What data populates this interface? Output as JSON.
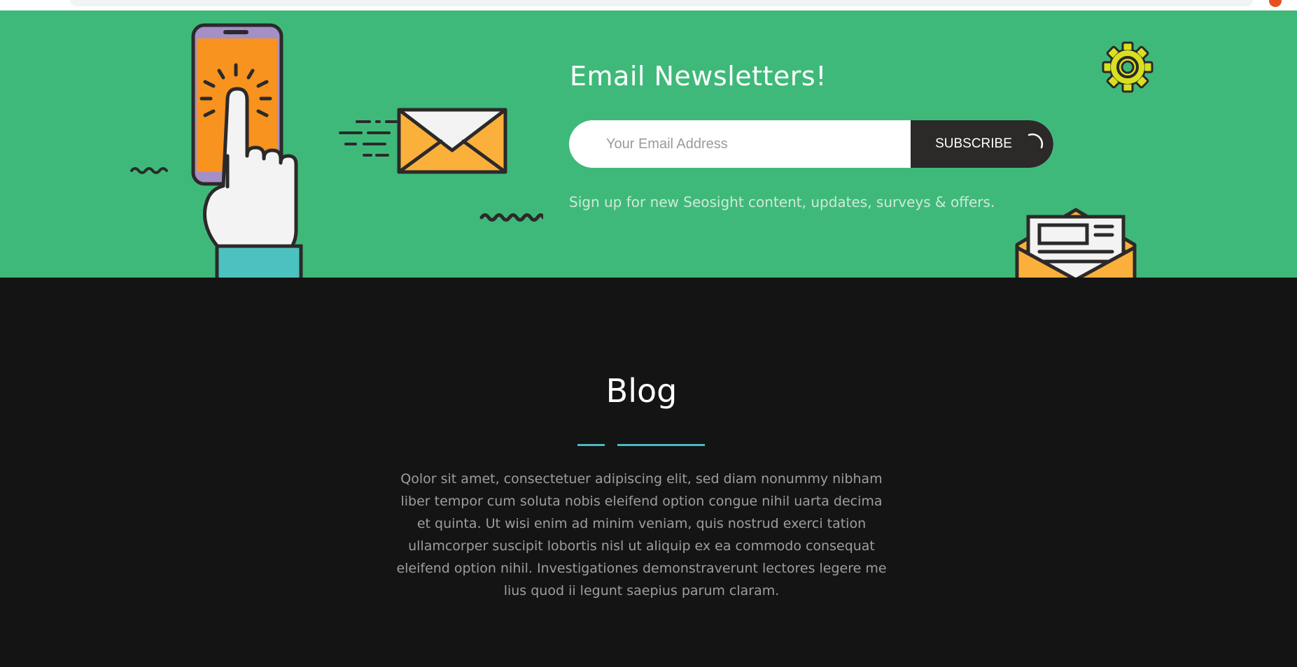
{
  "newsletter": {
    "title": "Email Newsletters!",
    "email_placeholder": "Your Email Address",
    "subscribe_label": "SUBSCRIBE",
    "subtext": "Sign up for new Seosight content, updates, surveys & offers.",
    "background_color": "#3fb97a",
    "icons": [
      "phone-tap-illustration",
      "envelope-icon",
      "gear-icon",
      "open-envelope-letter-icon",
      "squiggle-decoration",
      "spinner-icon"
    ]
  },
  "blog": {
    "title": "Blog",
    "description": "Qolor sit amet, consectetuer adipiscing elit, sed diam nonummy nibham liber tempor cum soluta nobis eleifend option congue nihil uarta decima et quinta. Ut wisi enim ad minim veniam, quis nostrud exerci tation ullamcorper suscipit lobortis nisl ut aliquip ex ea commodo consequat eleifend option nihil. Investigationes demonstraverunt lectores legere me lius quod ii legunt saepius parum claram.",
    "accent_color": "#4bb9c4",
    "background_color": "#141414"
  }
}
